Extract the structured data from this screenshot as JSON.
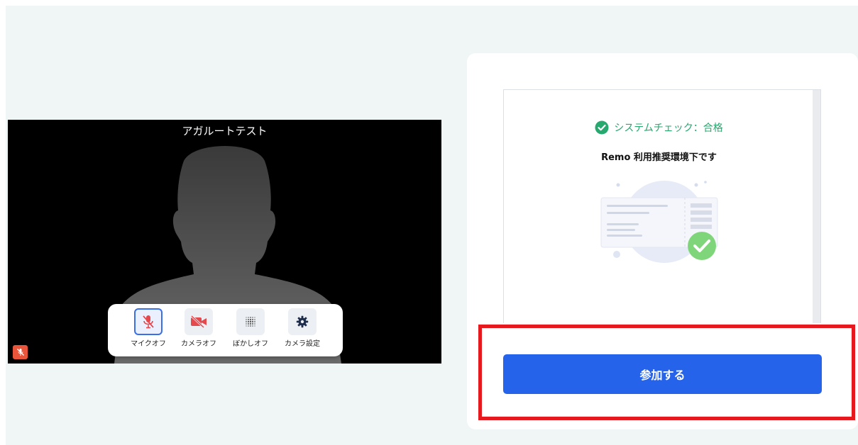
{
  "video": {
    "participant_name": "アガルートテスト",
    "mic_indicator_icon": "mic-off-icon"
  },
  "controls": [
    {
      "label": "マイクオフ",
      "icon": "mic-off-icon",
      "active": true
    },
    {
      "label": "カメラオフ",
      "icon": "camera-off-icon",
      "active": false
    },
    {
      "label": "ぼかしオフ",
      "icon": "blur-icon",
      "active": false
    },
    {
      "label": "カメラ設定",
      "icon": "gear-icon",
      "active": false
    }
  ],
  "system_check": {
    "status_text": "システムチェック：合格",
    "status_color": "#27a86e",
    "message": "Remo 利用推奨環境下です"
  },
  "join_button": {
    "label": "参加する",
    "color": "#2563eb"
  },
  "highlight_color": "#e5191e"
}
